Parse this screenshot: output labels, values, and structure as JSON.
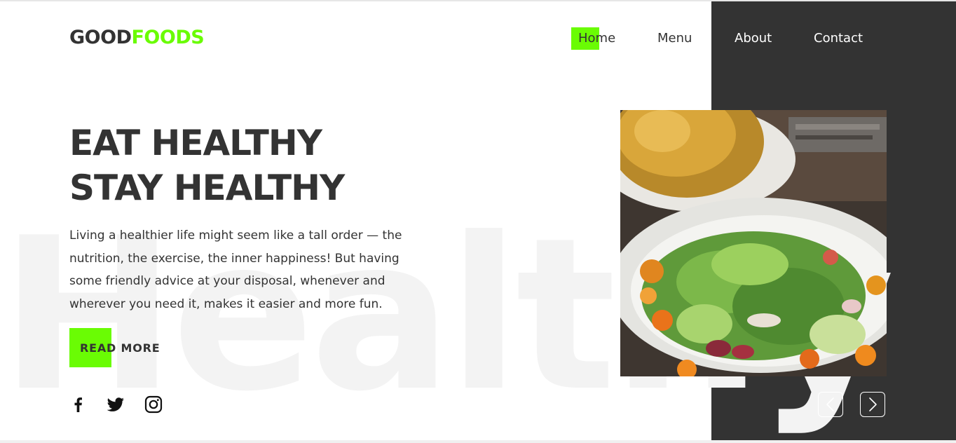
{
  "brand": {
    "part1": "GOOD",
    "part2": "FOODS"
  },
  "nav": {
    "home": "Home",
    "menu": "Menu",
    "about": "About",
    "contact": "Contact",
    "active": "Home"
  },
  "hero": {
    "title_line1": "EAT HEALTHY",
    "title_line2": "STAY HEALTHY",
    "paragraph": "Living a healthier life might seem like a tall order — the nutrition, the exercise, the inner happiness! But having some friendly advice at your disposal, whenever and wherever you need it, makes it easier and more fun.",
    "cta_label": "READ MORE",
    "watermark": "Healthy"
  },
  "social": {
    "icons": [
      "facebook-icon",
      "twitter-icon",
      "instagram-icon"
    ]
  },
  "slider": {
    "icons": [
      "chevron-left-icon",
      "chevron-right-icon"
    ]
  },
  "colors": {
    "accent": "#6afc04",
    "dark": "#333333",
    "text": "#333333",
    "background": "#ffffff",
    "watermark": "#f3f3f3"
  }
}
